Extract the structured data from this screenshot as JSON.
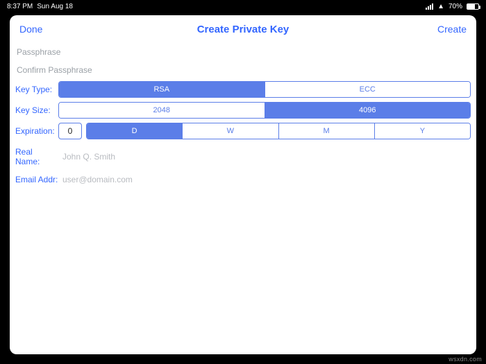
{
  "status": {
    "time": "8:37 PM",
    "date": "Sun Aug 18",
    "battery_pct": "70%"
  },
  "nav": {
    "done": "Done",
    "title": "Create Private Key",
    "create": "Create"
  },
  "passphrase": {
    "placeholder": "Passphrase",
    "confirm_placeholder": "Confirm Passphrase"
  },
  "keyType": {
    "label": "Key Type:",
    "options": [
      "RSA",
      "ECC"
    ],
    "selectedIndex": 0
  },
  "keySize": {
    "label": "Key Size:",
    "options": [
      "2048",
      "4096"
    ],
    "selectedIndex": 1
  },
  "expiration": {
    "label": "Expiration:",
    "value": "0",
    "units": [
      "D",
      "W",
      "M",
      "Y"
    ],
    "selectedIndex": 0
  },
  "realName": {
    "label": "Real Name:",
    "placeholder": "John Q. Smith"
  },
  "email": {
    "label": "Email Addr:",
    "placeholder": "user@domain.com"
  },
  "watermark": "wsxdn.com"
}
